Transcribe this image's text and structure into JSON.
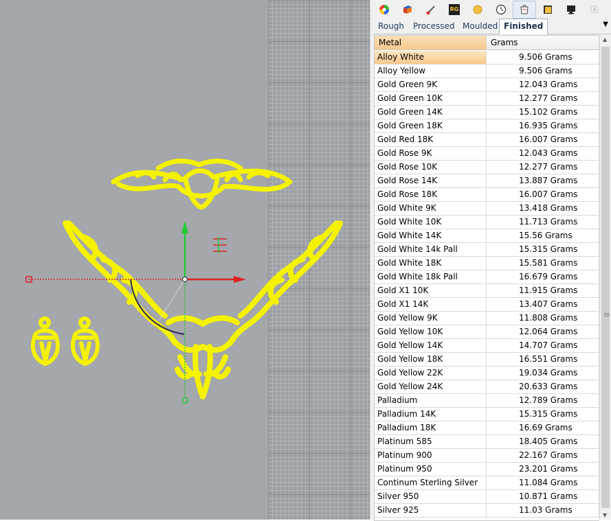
{
  "colors": {
    "jewelry": "#f5f200",
    "x_axis": "#e02020",
    "y_axis": "#22cc33",
    "viewport_bg": "#a4a7ab",
    "selected_header": "#f7c98e"
  },
  "toolbar": {
    "icons": [
      "color-wheel-icon",
      "material-icon",
      "brush-icon",
      "rg-icon",
      "gem-icon",
      "clock-icon",
      "weight-icon",
      "gold-sheet-icon",
      "monitor-icon",
      "settings-icon"
    ],
    "rg_label": "RG"
  },
  "tabs": [
    {
      "label": "Rough"
    },
    {
      "label": "Processed"
    },
    {
      "label": "Moulded"
    },
    {
      "label": "Finished"
    }
  ],
  "table": {
    "headers": {
      "metal": "Metal",
      "grams": "Grams"
    },
    "rows": [
      {
        "metal": "Alloy White",
        "grams": "9.506 Grams"
      },
      {
        "metal": "Alloy Yellow",
        "grams": "9.506 Grams"
      },
      {
        "metal": "Gold Green 9K",
        "grams": "12.043 Grams"
      },
      {
        "metal": "Gold Green 10K",
        "grams": "12.277 Grams"
      },
      {
        "metal": "Gold Green 14K",
        "grams": "15.102 Grams"
      },
      {
        "metal": "Gold Green 18K",
        "grams": "16.935 Grams"
      },
      {
        "metal": "Gold Red 18K",
        "grams": "16.007 Grams"
      },
      {
        "metal": "Gold Rose 9K",
        "grams": "12.043 Grams"
      },
      {
        "metal": "Gold Rose 10K",
        "grams": "12.277 Grams"
      },
      {
        "metal": "Gold Rose 14K",
        "grams": "13.887 Grams"
      },
      {
        "metal": "Gold Rose 18K",
        "grams": "16.007 Grams"
      },
      {
        "metal": "Gold White 9K",
        "grams": "13.418 Grams"
      },
      {
        "metal": "Gold White 10K",
        "grams": "11.713 Grams"
      },
      {
        "metal": "Gold White 14K",
        "grams": "15.56 Grams"
      },
      {
        "metal": "Gold White 14k Pall",
        "grams": "15.315 Grams"
      },
      {
        "metal": "Gold White 18K",
        "grams": "15.581 Grams"
      },
      {
        "metal": "Gold White 18k Pall",
        "grams": "16.679 Grams"
      },
      {
        "metal": "Gold X1 10K",
        "grams": "11.915 Grams"
      },
      {
        "metal": "Gold X1 14K",
        "grams": "13.407 Grams"
      },
      {
        "metal": "Gold Yellow 9K",
        "grams": "11.808 Grams"
      },
      {
        "metal": "Gold Yellow 10K",
        "grams": "12.064 Grams"
      },
      {
        "metal": "Gold Yellow 14K",
        "grams": "14.707 Grams"
      },
      {
        "metal": "Gold Yellow 18K",
        "grams": "16.551 Grams"
      },
      {
        "metal": "Gold Yellow 22K",
        "grams": "19.034 Grams"
      },
      {
        "metal": "Gold Yellow 24K",
        "grams": "20.633 Grams"
      },
      {
        "metal": "Palladium",
        "grams": "12.789 Grams"
      },
      {
        "metal": "Palladium 14K",
        "grams": "15.315 Grams"
      },
      {
        "metal": "Palladium 18K",
        "grams": "16.69 Grams"
      },
      {
        "metal": "Platinum 585",
        "grams": "18.405 Grams"
      },
      {
        "metal": "Platinum 900",
        "grams": "22.167 Grams"
      },
      {
        "metal": "Platinum 950",
        "grams": "23.201 Grams"
      },
      {
        "metal": "Continum Sterling Silver",
        "grams": "11.084 Grams"
      },
      {
        "metal": "Silver 950",
        "grams": "10.871 Grams"
      },
      {
        "metal": "Silver 925",
        "grams": "11.03 Grams"
      }
    ]
  }
}
